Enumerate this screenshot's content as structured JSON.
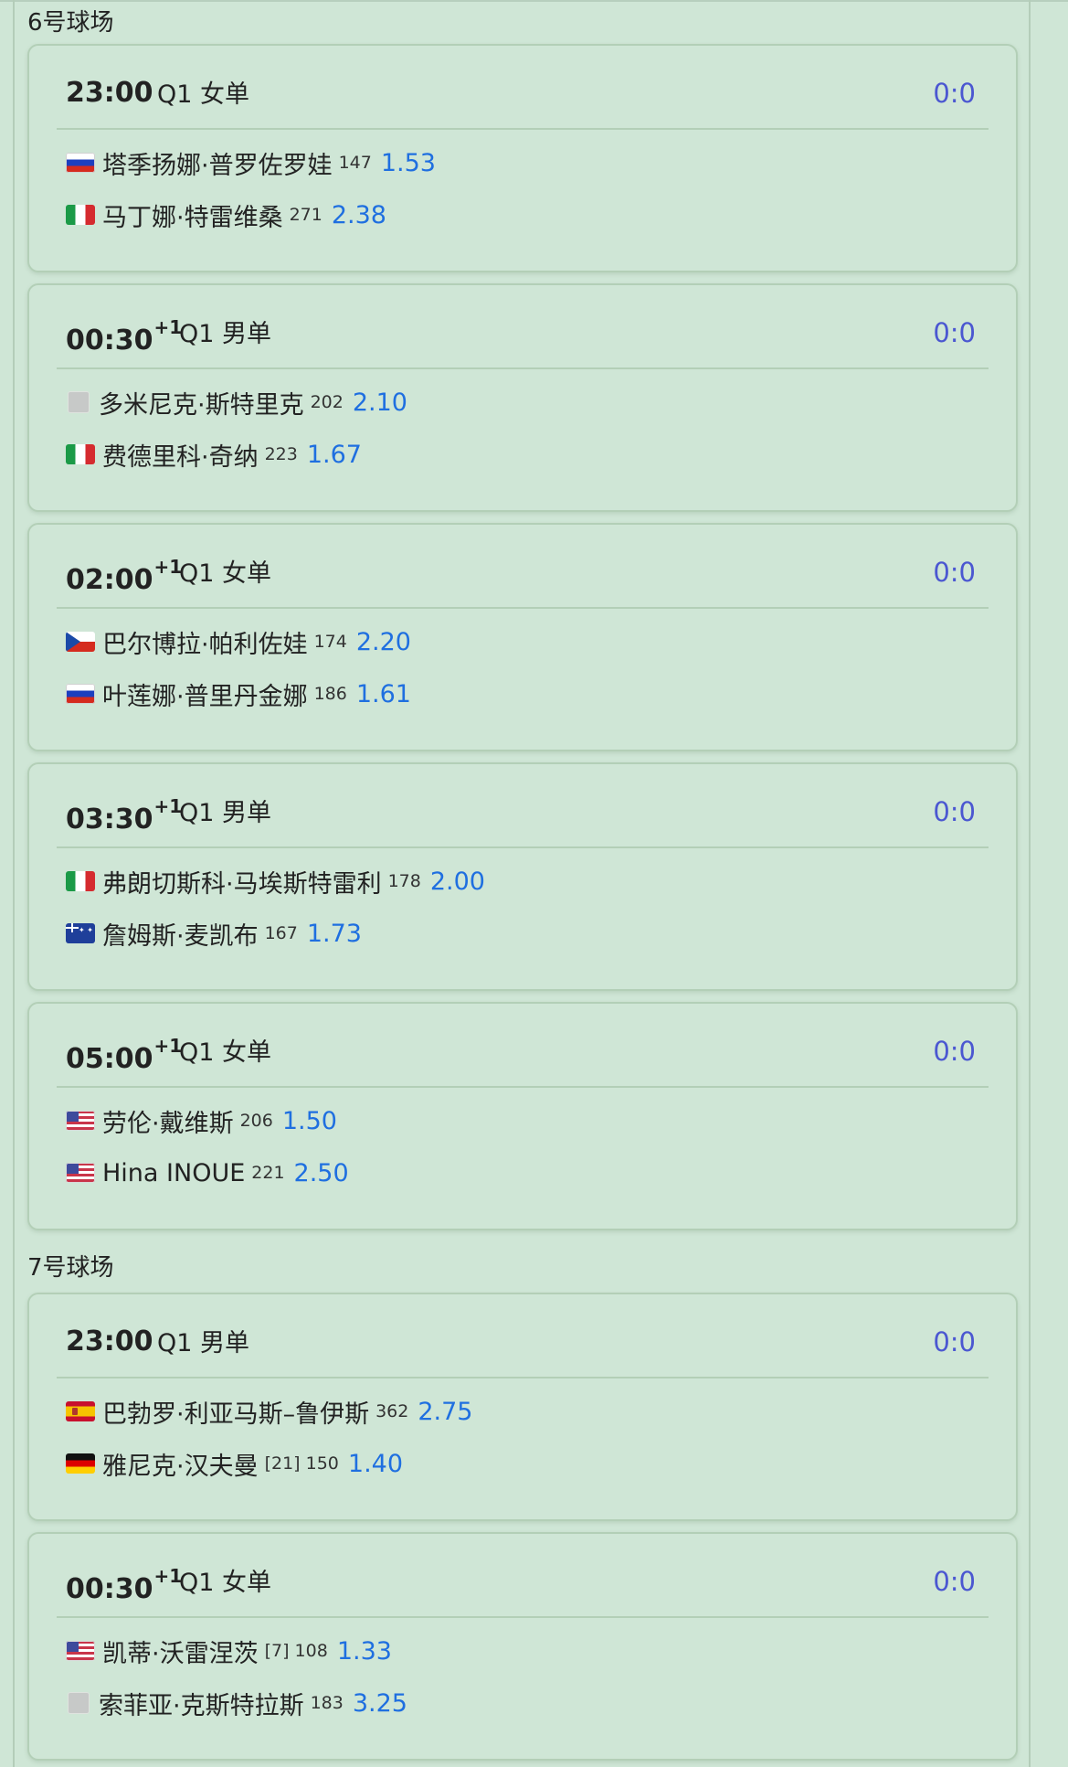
{
  "venues": [
    {
      "title": "6号球场",
      "matches": [
        {
          "time": "23:00",
          "day_offset": "",
          "round": "Q1",
          "category": "女单",
          "score": "0:0",
          "players": [
            {
              "flag": "flag-russia-icon",
              "flag_class": "flag-ru",
              "name": "塔季扬娜·普罗佐罗娃",
              "rank": "147",
              "odds": "1.53"
            },
            {
              "flag": "flag-italy-icon",
              "flag_class": "flag-it",
              "name": "马丁娜·特雷维桑",
              "rank": "271",
              "odds": "2.38"
            }
          ]
        },
        {
          "time": "00:30",
          "day_offset": "+1",
          "round": "Q1",
          "category": "男单",
          "score": "0:0",
          "players": [
            {
              "flag": "flag-placeholder-icon",
              "flag_class": "placeholder",
              "name": "多米尼克·斯特里克",
              "rank": "202",
              "odds": "2.10"
            },
            {
              "flag": "flag-italy-icon",
              "flag_class": "flag-it",
              "name": "费德里科·奇纳",
              "rank": "223",
              "odds": "1.67"
            }
          ]
        },
        {
          "time": "02:00",
          "day_offset": "+1",
          "round": "Q1",
          "category": "女单",
          "score": "0:0",
          "players": [
            {
              "flag": "flag-czech-icon",
              "flag_class": "flag-cz",
              "name": "巴尔博拉·帕利佐娃",
              "rank": "174",
              "odds": "2.20"
            },
            {
              "flag": "flag-russia-icon",
              "flag_class": "flag-ru",
              "name": "叶莲娜·普里丹金娜",
              "rank": "186",
              "odds": "1.61"
            }
          ]
        },
        {
          "time": "03:30",
          "day_offset": "+1",
          "round": "Q1",
          "category": "男单",
          "score": "0:0",
          "players": [
            {
              "flag": "flag-italy-icon",
              "flag_class": "flag-it",
              "name": "弗朗切斯科·马埃斯特雷利",
              "rank": "178",
              "odds": "2.00"
            },
            {
              "flag": "flag-australia-icon",
              "flag_class": "flag-au",
              "name": "詹姆斯·麦凯布",
              "rank": "167",
              "odds": "1.73"
            }
          ]
        },
        {
          "time": "05:00",
          "day_offset": "+1",
          "round": "Q1",
          "category": "女单",
          "score": "0:0",
          "players": [
            {
              "flag": "flag-usa-icon",
              "flag_class": "flag-us",
              "name": "劳伦·戴维斯",
              "rank": "206",
              "odds": "1.50"
            },
            {
              "flag": "flag-usa-icon",
              "flag_class": "flag-us",
              "name": "Hina INOUE",
              "rank": "221",
              "odds": "2.50"
            }
          ]
        }
      ]
    },
    {
      "title": "7号球场",
      "matches": [
        {
          "time": "23:00",
          "day_offset": "",
          "round": "Q1",
          "category": "男单",
          "score": "0:0",
          "players": [
            {
              "flag": "flag-spain-icon",
              "flag_class": "flag-es",
              "name": "巴勃罗·利亚马斯–鲁伊斯",
              "rank": "362",
              "odds": "2.75"
            },
            {
              "flag": "flag-germany-icon",
              "flag_class": "flag-de",
              "name": "雅尼克·汉夫曼",
              "rank": "[21] 150",
              "odds": "1.40"
            }
          ]
        },
        {
          "time": "00:30",
          "day_offset": "+1",
          "round": "Q1",
          "category": "女单",
          "score": "0:0",
          "players": [
            {
              "flag": "flag-usa-icon",
              "flag_class": "flag-us",
              "name": "凯蒂·沃雷涅茨",
              "rank": "[7] 108",
              "odds": "1.33"
            },
            {
              "flag": "flag-placeholder-icon",
              "flag_class": "placeholder",
              "name": "索菲亚·克斯特拉斯",
              "rank": "183",
              "odds": "3.25"
            }
          ]
        }
      ]
    }
  ]
}
